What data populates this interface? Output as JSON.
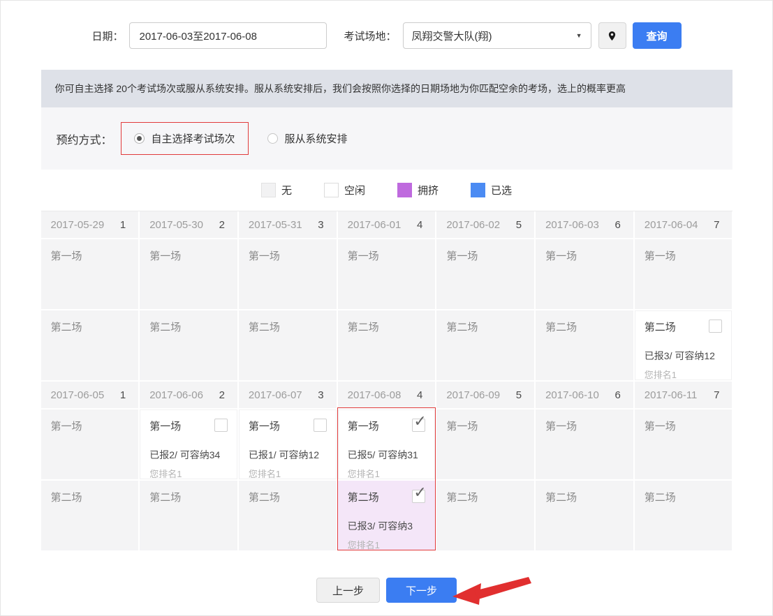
{
  "filters": {
    "date_label": "日期：",
    "date_value": "2017-06-03至2017-06-08",
    "venue_label": "考试场地：",
    "venue_value": "凤翔交警大队(翔)",
    "query_button": "查询"
  },
  "notice": "你可自主选择 20个考试场次或服从系统安排。服从系统安排后，我们会按照你选择的日期场地为你匹配空余的考场，选上的概率更高",
  "booking": {
    "label": "预约方式：",
    "options": [
      {
        "label": "自主选择考试场次",
        "selected": true,
        "highlighted": true
      },
      {
        "label": "服从系统安排",
        "selected": false,
        "highlighted": false
      }
    ]
  },
  "legend": [
    {
      "label": "无",
      "color": "#f2f2f3",
      "border": "#e2e2e2"
    },
    {
      "label": "空闲",
      "color": "#ffffff",
      "border": "#dcdcdc"
    },
    {
      "label": "拥挤",
      "color": "#bf6ade",
      "border": "#bf6ade"
    },
    {
      "label": "已选",
      "color": "#4b8bf3",
      "border": "#4b8bf3"
    }
  ],
  "colors": {
    "primary_blue": "#3b7df2",
    "highlight_red": "#e13b3b",
    "crowded_cell_bg": "#f4e6f8",
    "notice_bg": "#dee1e8"
  },
  "weeks": [
    {
      "days": [
        {
          "date": "2017-05-29",
          "num": "1",
          "highlighted": false,
          "sessions": [
            {
              "name": "第一场",
              "state": "none"
            },
            {
              "name": "第二场",
              "state": "none"
            }
          ]
        },
        {
          "date": "2017-05-30",
          "num": "2",
          "highlighted": false,
          "sessions": [
            {
              "name": "第一场",
              "state": "none"
            },
            {
              "name": "第二场",
              "state": "none"
            }
          ]
        },
        {
          "date": "2017-05-31",
          "num": "3",
          "highlighted": false,
          "sessions": [
            {
              "name": "第一场",
              "state": "none"
            },
            {
              "name": "第二场",
              "state": "none"
            }
          ]
        },
        {
          "date": "2017-06-01",
          "num": "4",
          "highlighted": false,
          "sessions": [
            {
              "name": "第一场",
              "state": "none"
            },
            {
              "name": "第二场",
              "state": "none"
            }
          ]
        },
        {
          "date": "2017-06-02",
          "num": "5",
          "highlighted": false,
          "sessions": [
            {
              "name": "第一场",
              "state": "none"
            },
            {
              "name": "第二场",
              "state": "none"
            }
          ]
        },
        {
          "date": "2017-06-03",
          "num": "6",
          "highlighted": false,
          "sessions": [
            {
              "name": "第一场",
              "state": "none"
            },
            {
              "name": "第二场",
              "state": "none"
            }
          ]
        },
        {
          "date": "2017-06-04",
          "num": "7",
          "highlighted": false,
          "sessions": [
            {
              "name": "第一场",
              "state": "none"
            },
            {
              "name": "第二场",
              "state": "free",
              "checked": false,
              "enrolled": "已报3/ 可容纳12",
              "rank": "您排名1"
            }
          ]
        }
      ]
    },
    {
      "days": [
        {
          "date": "2017-06-05",
          "num": "1",
          "highlighted": false,
          "sessions": [
            {
              "name": "第一场",
              "state": "none"
            },
            {
              "name": "第二场",
              "state": "none"
            }
          ]
        },
        {
          "date": "2017-06-06",
          "num": "2",
          "highlighted": false,
          "sessions": [
            {
              "name": "第一场",
              "state": "free",
              "checked": false,
              "enrolled": "已报2/ 可容纳34",
              "rank": "您排名1"
            },
            {
              "name": "第二场",
              "state": "none"
            }
          ]
        },
        {
          "date": "2017-06-07",
          "num": "3",
          "highlighted": false,
          "sessions": [
            {
              "name": "第一场",
              "state": "free",
              "checked": false,
              "enrolled": "已报1/ 可容纳12",
              "rank": "您排名1"
            },
            {
              "name": "第二场",
              "state": "none"
            }
          ]
        },
        {
          "date": "2017-06-08",
          "num": "4",
          "highlighted": true,
          "sessions": [
            {
              "name": "第一场",
              "state": "free",
              "checked": true,
              "enrolled": "已报5/ 可容纳31",
              "rank": "您排名1"
            },
            {
              "name": "第二场",
              "state": "crowded",
              "checked": true,
              "enrolled": "已报3/ 可容纳3",
              "rank": "您排名1"
            }
          ]
        },
        {
          "date": "2017-06-09",
          "num": "5",
          "highlighted": false,
          "sessions": [
            {
              "name": "第一场",
              "state": "none"
            },
            {
              "name": "第二场",
              "state": "none"
            }
          ]
        },
        {
          "date": "2017-06-10",
          "num": "6",
          "highlighted": false,
          "sessions": [
            {
              "name": "第一场",
              "state": "none"
            },
            {
              "name": "第二场",
              "state": "none"
            }
          ]
        },
        {
          "date": "2017-06-11",
          "num": "7",
          "highlighted": false,
          "sessions": [
            {
              "name": "第一场",
              "state": "none"
            },
            {
              "name": "第二场",
              "state": "none"
            }
          ]
        }
      ]
    }
  ],
  "footer": {
    "prev": "上一步",
    "next": "下一步"
  }
}
